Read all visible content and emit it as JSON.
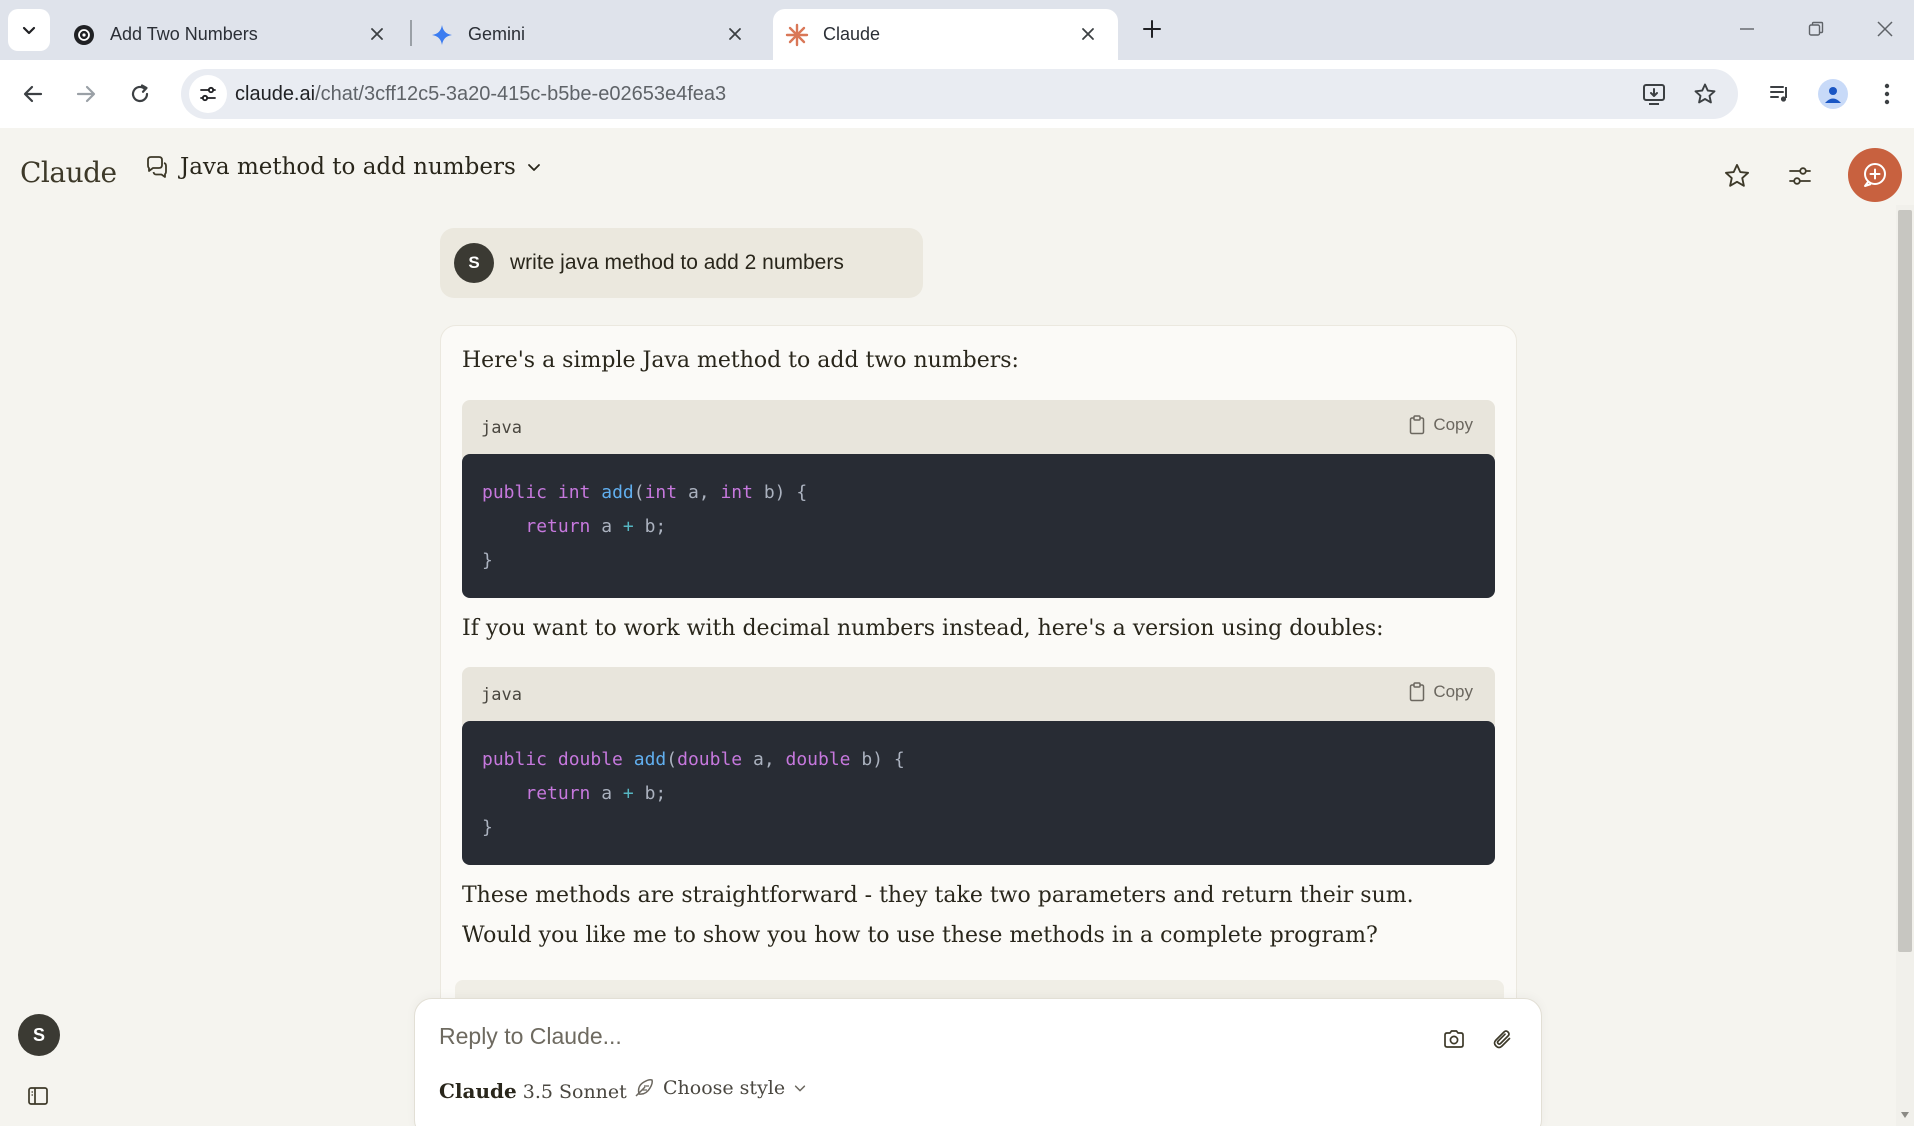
{
  "browser": {
    "tabs": [
      {
        "title": "Add Two Numbers",
        "favicon": "openai-icon",
        "active": false
      },
      {
        "title": "Gemini",
        "favicon": "gemini-icon",
        "active": false
      },
      {
        "title": "Claude",
        "favicon": "claude-icon",
        "active": true
      }
    ],
    "url_domain": "claude.ai",
    "url_path": "/chat/3cff12c5-3a20-415c-b5be-e02653e4fea3"
  },
  "header": {
    "logo": "Claude",
    "chat_title": "Java method to add numbers"
  },
  "conversation": {
    "user_message": {
      "avatar_initial": "S",
      "text": "write java method to add 2 numbers"
    },
    "assistant": {
      "intro": "Here's a simple Java method to add two numbers:",
      "middle": "If you want to work with decimal numbers instead, here's a version using doubles:",
      "outro_line1": "These methods are straightforward - they take two parameters and return their sum.",
      "outro_line2": "Would you like me to show you how to use these methods in a complete program?",
      "code_blocks": [
        {
          "lang": "java",
          "copy_label": "Copy",
          "lines": [
            [
              {
                "t": "public",
                "c": "kw"
              },
              {
                "t": " "
              },
              {
                "t": "int",
                "c": "kw"
              },
              {
                "t": " "
              },
              {
                "t": "add",
                "c": "fn"
              },
              {
                "t": "("
              },
              {
                "t": "int",
                "c": "kw"
              },
              {
                "t": " a, "
              },
              {
                "t": "int",
                "c": "kw"
              },
              {
                "t": " b) {"
              }
            ],
            [
              {
                "t": "    "
              },
              {
                "t": "return",
                "c": "kw"
              },
              {
                "t": " a "
              },
              {
                "t": "+",
                "c": "op"
              },
              {
                "t": " b;"
              }
            ],
            [
              {
                "t": "}"
              }
            ]
          ]
        },
        {
          "lang": "java",
          "copy_label": "Copy",
          "lines": [
            [
              {
                "t": "public",
                "c": "kw"
              },
              {
                "t": " "
              },
              {
                "t": "double",
                "c": "kw"
              },
              {
                "t": " "
              },
              {
                "t": "add",
                "c": "fn"
              },
              {
                "t": "("
              },
              {
                "t": "double",
                "c": "kw"
              },
              {
                "t": " a, "
              },
              {
                "t": "double",
                "c": "kw"
              },
              {
                "t": " b) {"
              }
            ],
            [
              {
                "t": "    "
              },
              {
                "t": "return",
                "c": "kw"
              },
              {
                "t": " a "
              },
              {
                "t": "+",
                "c": "op"
              },
              {
                "t": " b;"
              }
            ],
            [
              {
                "t": "}"
              }
            ]
          ]
        }
      ]
    }
  },
  "composer": {
    "placeholder": "Reply to Claude...",
    "model_brand": "Claude",
    "model_name": "3.5 Sonnet",
    "style_label": "Choose style"
  },
  "sidebar": {
    "avatar_initial": "S"
  },
  "colors": {
    "accent": "#c8613f",
    "page_bg": "#f5f4ef",
    "code_bg": "#282c34"
  }
}
